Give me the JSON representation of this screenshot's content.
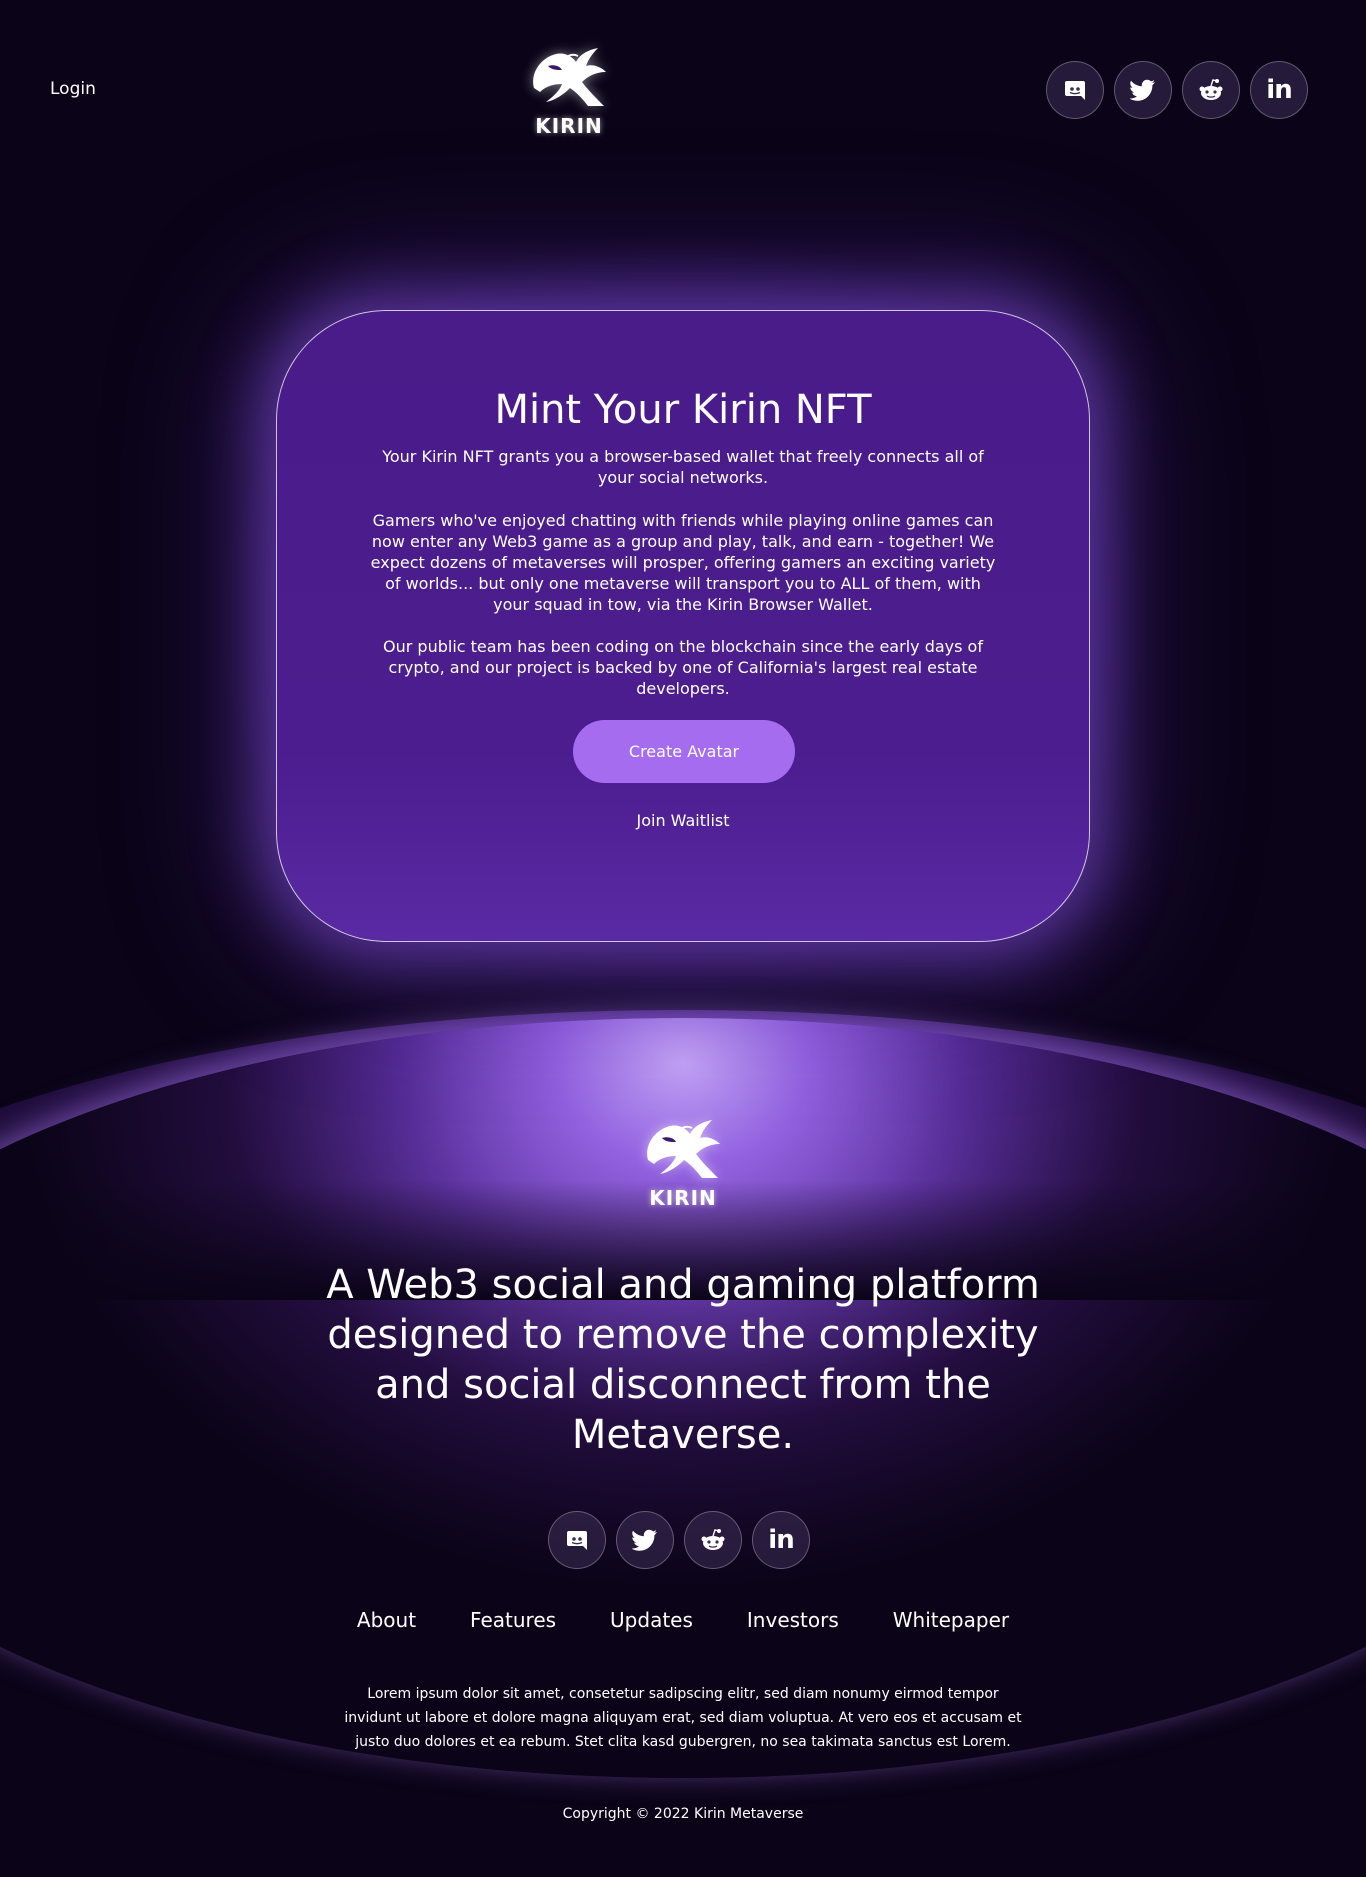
{
  "header": {
    "login_label": "Login",
    "logo_word": "KIRIN"
  },
  "social": [
    {
      "name": "discord-icon"
    },
    {
      "name": "twitter-icon"
    },
    {
      "name": "reddit-icon"
    },
    {
      "name": "linkedin-icon",
      "glyph": "in"
    }
  ],
  "card": {
    "title": "Mint Your Kirin NFT",
    "paragraph_1": "Your Kirin NFT grants you a browser-based wallet that freely connects all of your social networks.",
    "paragraph_2": "Gamers who've enjoyed chatting with friends while playing online games can now enter any Web3 game as a group and play, talk, and earn - together! We expect dozens of metaverses will prosper, offering gamers an exciting variety of worlds... but only one metaverse will transport you to ALL of them, with your squad in tow, via the Kirin Browser Wallet.",
    "paragraph_3": "Our public team has been coding on the blockchain since the early days of crypto, and our project is backed by one of California's largest real estate developers.",
    "primary_button": "Create Avatar",
    "secondary_link": "Join Waitlist"
  },
  "footer": {
    "logo_word": "KIRIN",
    "tagline": "A Web3 social and gaming platform designed to remove the complexity and social disconnect from the Metaverse.",
    "nav": [
      "About",
      "Features",
      "Updates",
      "Investors",
      "Whitepaper"
    ],
    "lorem": "Lorem ipsum dolor sit amet, consetetur sadipscing elitr, sed diam nonumy eirmod tempor invidunt ut labore et dolore magna aliquyam erat, sed diam voluptua. At vero eos et accusam et justo duo dolores et ea rebum. Stet clita kasd gubergren, no sea takimata sanctus est Lorem.",
    "copyright": "Copyright © 2022 Kirin Metaverse"
  },
  "colors": {
    "background": "#0b0418",
    "card": "#4a1c8a",
    "button": "#a56cf0"
  }
}
